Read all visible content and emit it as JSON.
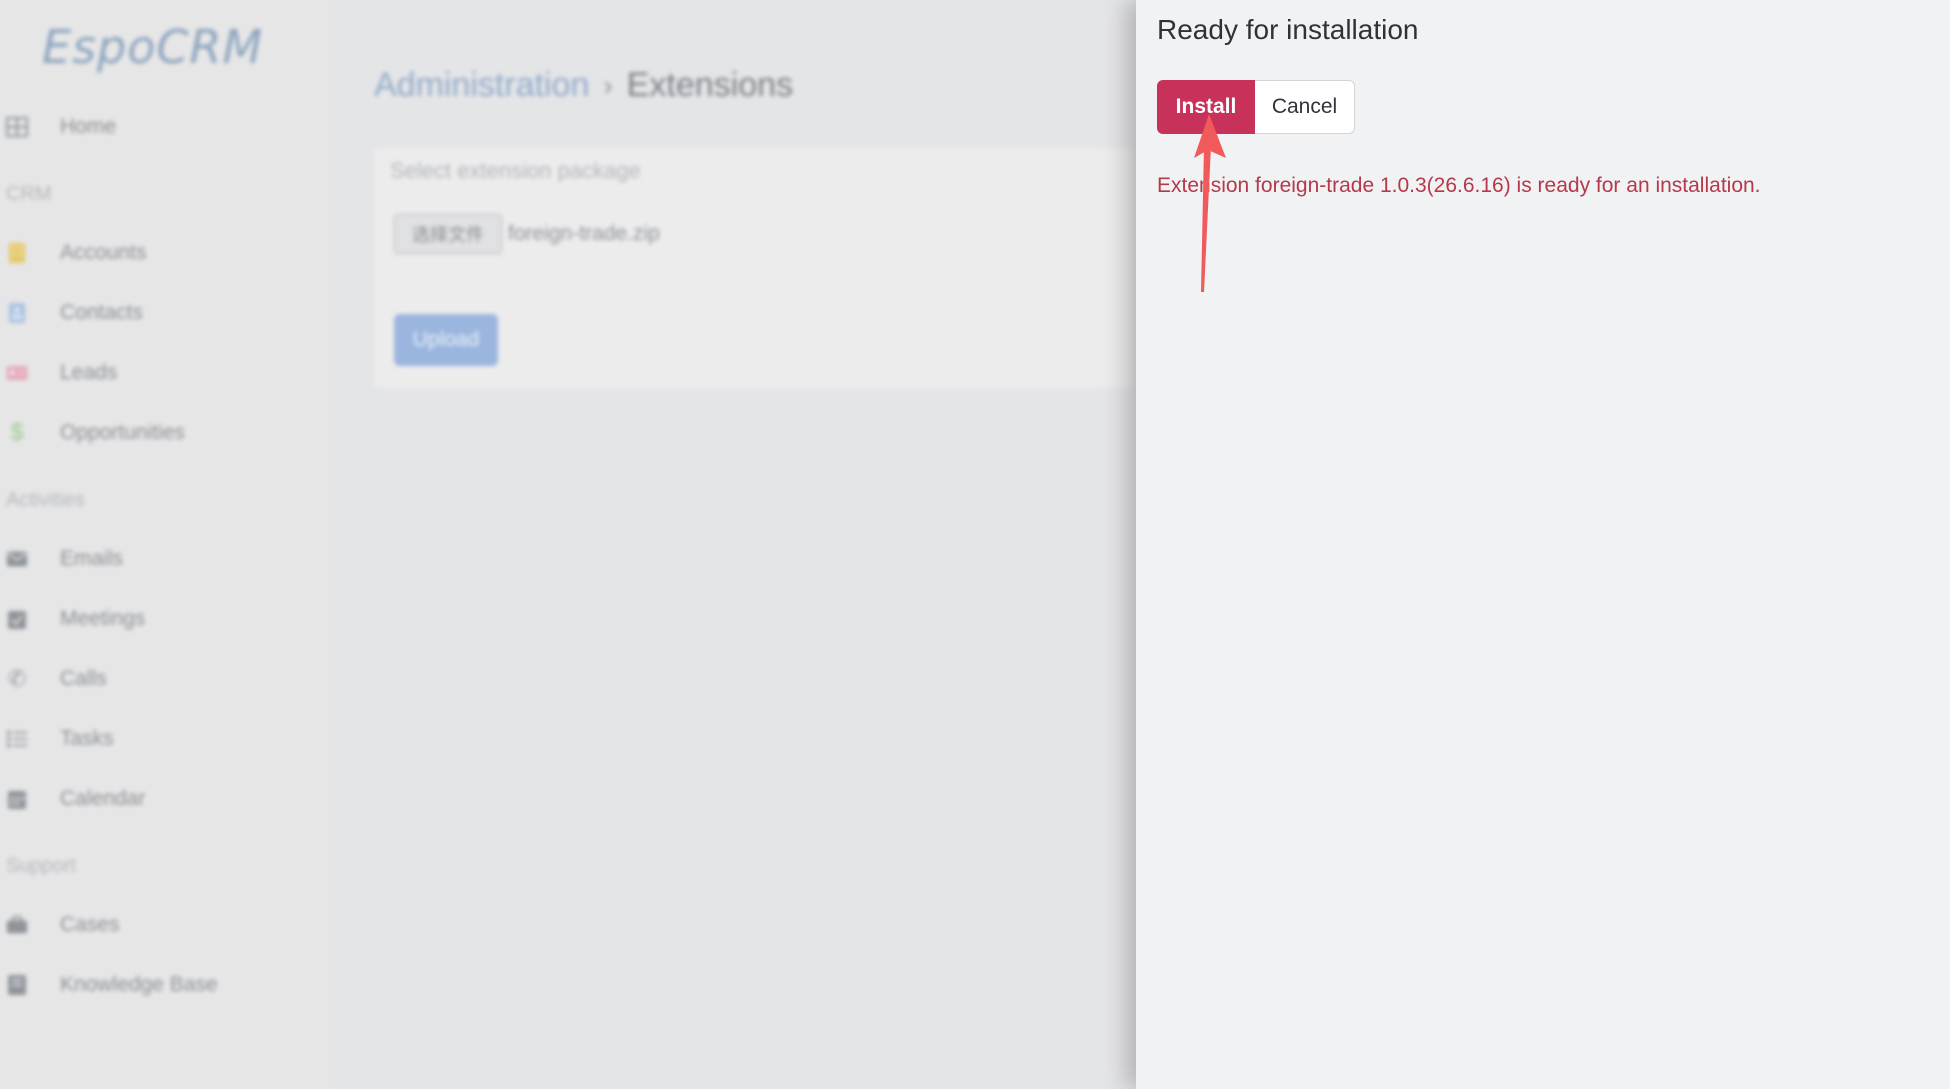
{
  "app": {
    "logo": "EspoCRM"
  },
  "sidebar": {
    "items": [
      {
        "label": "Home",
        "icon": "grid-icon"
      },
      {
        "group": "CRM"
      },
      {
        "label": "Accounts",
        "icon": "building-icon",
        "color": "#e5c96a"
      },
      {
        "label": "Contacts",
        "icon": "contact-card-icon",
        "color": "#a9c2e4"
      },
      {
        "label": "Leads",
        "icon": "id-card-icon",
        "color": "#e3a2b4"
      },
      {
        "label": "Opportunities",
        "icon": "dollar-icon",
        "color": "#9bc98d"
      },
      {
        "group": "Activities"
      },
      {
        "label": "Emails",
        "icon": "envelope-icon"
      },
      {
        "label": "Meetings",
        "icon": "calendar-check-icon"
      },
      {
        "label": "Calls",
        "icon": "phone-icon"
      },
      {
        "label": "Tasks",
        "icon": "task-list-icon"
      },
      {
        "label": "Calendar",
        "icon": "calendar-icon"
      },
      {
        "group": "Support"
      },
      {
        "label": "Cases",
        "icon": "briefcase-icon"
      },
      {
        "label": "Knowledge Base",
        "icon": "book-icon"
      }
    ]
  },
  "breadcrumb": {
    "parent": "Administration",
    "separator": "›",
    "current": "Extensions"
  },
  "extension_panel": {
    "heading": "Select extension package",
    "file_button": "选择文件",
    "file_name": "foreign-trade.zip",
    "upload_button": "Upload"
  },
  "modal": {
    "title": "Ready for installation",
    "install_button": "Install",
    "cancel_button": "Cancel",
    "message": "Extension foreign-trade 1.0.3(26.6.16) is ready for an installation."
  },
  "colors": {
    "install": "#c8325a",
    "message": "#b5394a",
    "annotation_arrow": "#f05a5a"
  }
}
